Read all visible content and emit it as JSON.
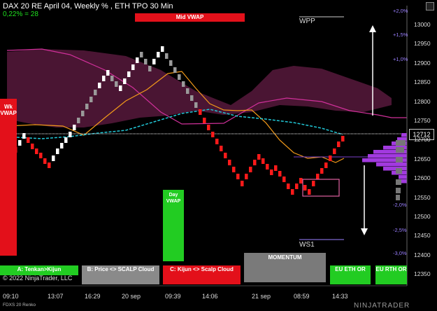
{
  "header": {
    "line1": "DAX 20  RE April 04, Weekly % , ETH TPO 30 Min",
    "line2": "0,22% = 28"
  },
  "labels": {
    "mid_vwap": "Mid VWAP",
    "wk_vwap": "Wk VWAP",
    "day_vwap": "Day VWAP",
    "wpp": "WPP",
    "ws1": "WS1",
    "momentum": "MOMENTUM",
    "price_tag": "12712"
  },
  "buttons": {
    "a": "A: Tenkan>Kijun",
    "b": "B: Price <> SCALP Cloud",
    "c": "C: Kijun <> Scalp Cloud",
    "eu_eth": "EU ETH OR",
    "eu_rth": "EU RTH OR"
  },
  "copyright": "© 2022 NinjaTrader, LLC",
  "footer_instrument": "FDXS 20 Renko",
  "logo": "NINJATRADER",
  "y_axis": {
    "ticks": [
      "13000",
      "12950",
      "12900",
      "12850",
      "12800",
      "12750",
      "12700",
      "12650",
      "12600",
      "12550",
      "12500",
      "12450",
      "12400",
      "12350"
    ],
    "pct": [
      "+2,0%",
      "+1,5%",
      "+1,0%",
      "-2,0%",
      "-2,5%",
      "-3,0%"
    ]
  },
  "x_axis": [
    "09:10",
    "13:07",
    "16:29",
    "20 sep",
    "09:39",
    "14:06",
    "21 sep",
    "08:59",
    "14:33"
  ],
  "colors": {
    "up_brick": "#ffffff",
    "down_brick": "#ff1a1a",
    "cloud": "#4a1533",
    "mid_vwap_bg": "#e3101a",
    "day_vwap_bg": "#22cc22",
    "vwap_line": "#21c7d6",
    "orange_line": "#f29a1a",
    "magenta_line": "#d0309a",
    "volume_profile": "#a23adf"
  }
}
